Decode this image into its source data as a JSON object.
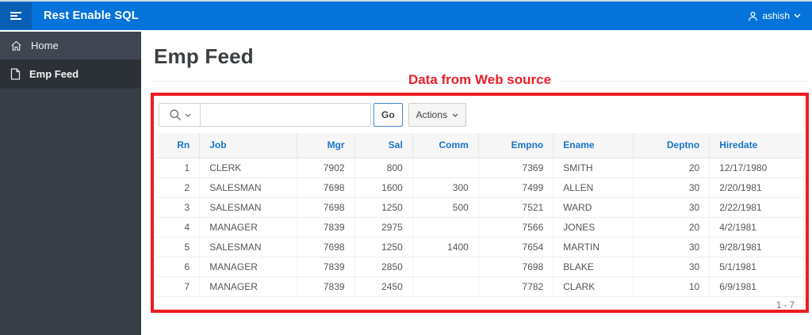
{
  "app": {
    "title": "Rest Enable SQL",
    "user_name": "ashish"
  },
  "sidebar": {
    "items": [
      {
        "label": "Home",
        "icon": "home-icon",
        "active": false
      },
      {
        "label": "Emp Feed",
        "icon": "document-icon",
        "active": true
      }
    ]
  },
  "page": {
    "title": "Emp Feed",
    "annotation": "Data from Web source"
  },
  "toolbar": {
    "search_value": "",
    "search_placeholder": "",
    "go_label": "Go",
    "actions_label": "Actions"
  },
  "report": {
    "columns": [
      {
        "label": "Rn",
        "align": "right",
        "width_pct": 6.6
      },
      {
        "label": "Job",
        "align": "left",
        "width_pct": 15.1
      },
      {
        "label": "Mgr",
        "align": "right",
        "width_pct": 8.9
      },
      {
        "label": "Sal",
        "align": "right",
        "width_pct": 9.0
      },
      {
        "label": "Comm",
        "align": "right",
        "width_pct": 10.2
      },
      {
        "label": "Empno",
        "align": "right",
        "width_pct": 11.6
      },
      {
        "label": "Ename",
        "align": "left",
        "width_pct": 12.4
      },
      {
        "label": "Deptno",
        "align": "right",
        "width_pct": 11.8
      },
      {
        "label": "Hiredate",
        "align": "left",
        "width_pct": 14.4
      }
    ],
    "rows": [
      [
        "1",
        "CLERK",
        "7902",
        "800",
        "",
        "7369",
        "SMITH",
        "20",
        "12/17/1980"
      ],
      [
        "2",
        "SALESMAN",
        "7698",
        "1600",
        "300",
        "7499",
        "ALLEN",
        "30",
        "2/20/1981"
      ],
      [
        "3",
        "SALESMAN",
        "7698",
        "1250",
        "500",
        "7521",
        "WARD",
        "30",
        "2/22/1981"
      ],
      [
        "4",
        "MANAGER",
        "7839",
        "2975",
        "",
        "7566",
        "JONES",
        "20",
        "4/2/1981"
      ],
      [
        "5",
        "SALESMAN",
        "7698",
        "1250",
        "1400",
        "7654",
        "MARTIN",
        "30",
        "9/28/1981"
      ],
      [
        "6",
        "MANAGER",
        "7839",
        "2850",
        "",
        "7698",
        "BLAKE",
        "30",
        "5/1/1981"
      ],
      [
        "7",
        "MANAGER",
        "7839",
        "2450",
        "",
        "7782",
        "CLARK",
        "10",
        "6/9/1981"
      ]
    ],
    "pagination": "1 - 7"
  },
  "colors": {
    "header_bar_blue": "#0573d9",
    "menu_button_blue": "#0a5fb5",
    "sidebar_dark": "#373e47",
    "sidebar_active": "#2c3137",
    "column_link_blue": "#1a75c9",
    "annotation_red": "#ee1d23",
    "go_border_blue": "#3f8ad8"
  }
}
